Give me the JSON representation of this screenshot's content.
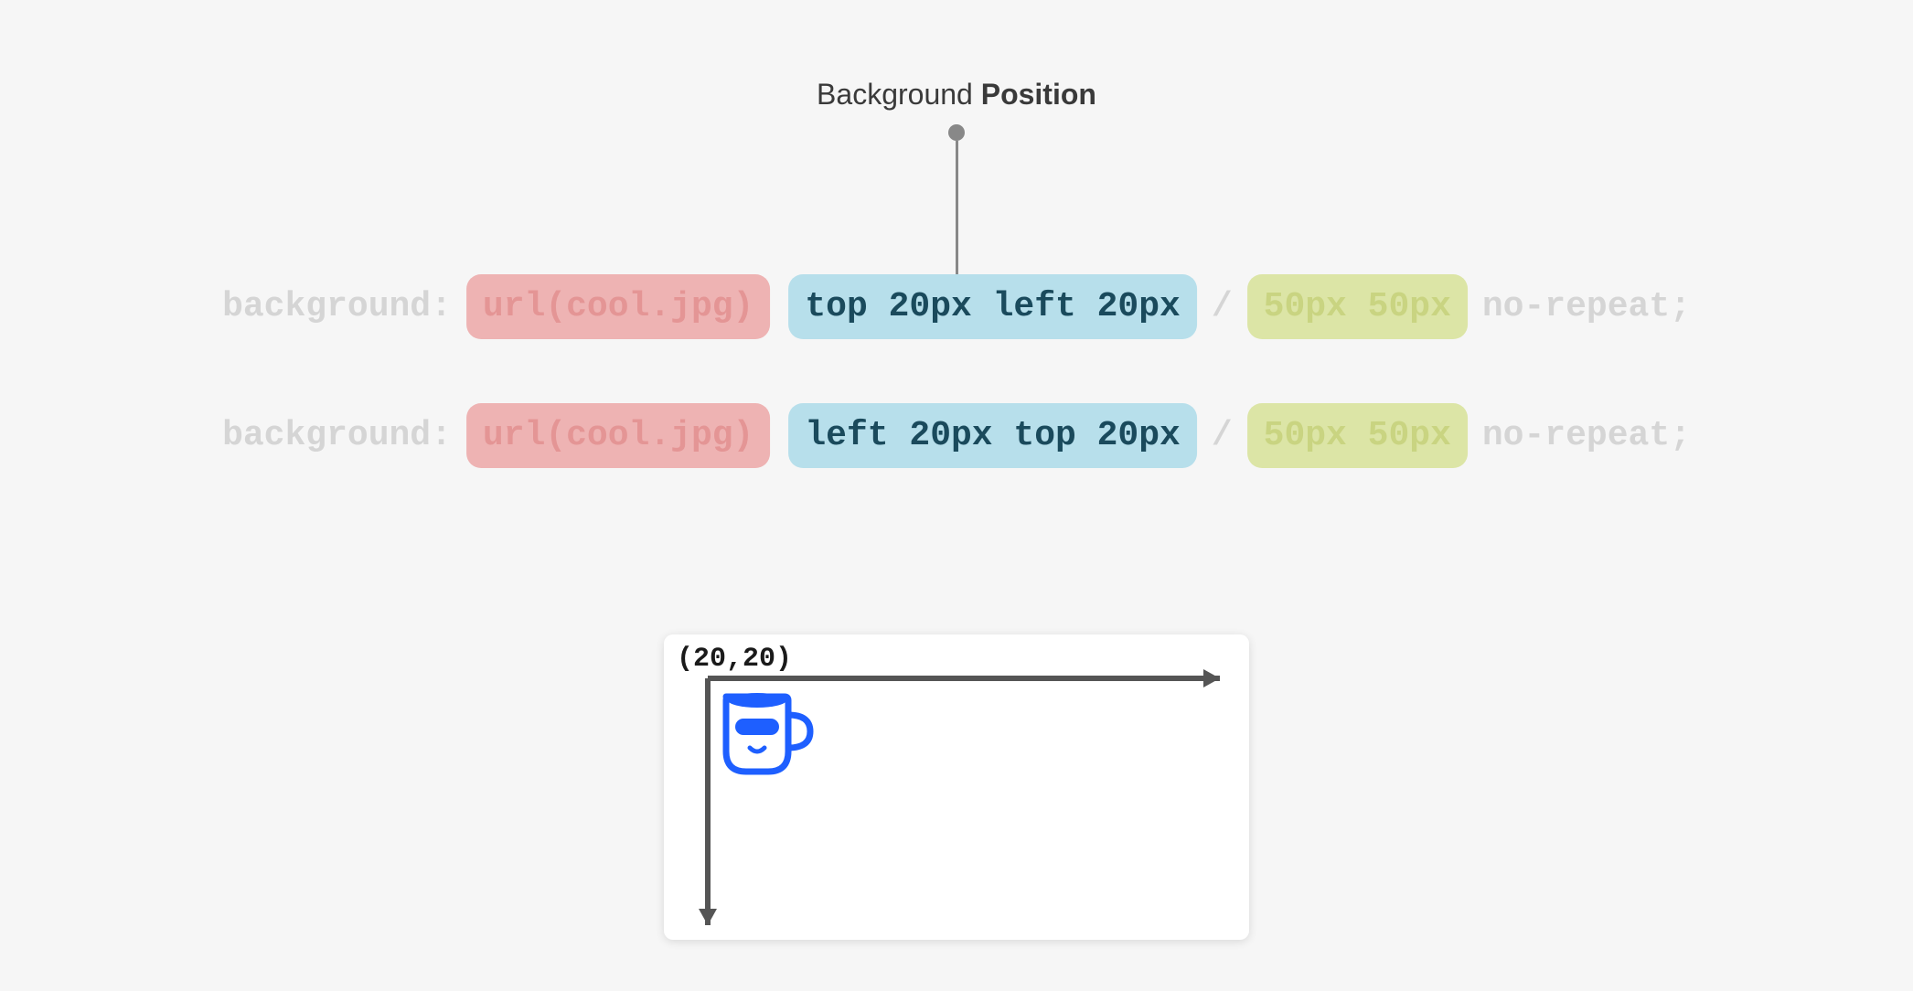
{
  "heading": {
    "prefix": "Background ",
    "bold": "Position"
  },
  "rows": [
    {
      "property": "background:",
      "url": "url(cool.jpg)",
      "position": "top 20px left 20px",
      "separator": "/",
      "size": "50px 50px",
      "repeat": "no-repeat;"
    },
    {
      "property": "background:",
      "url": "url(cool.jpg)",
      "position": "left 20px top 20px",
      "separator": "/",
      "size": "50px 50px",
      "repeat": "no-repeat;"
    }
  ],
  "preview": {
    "coord_label": "(20,20)"
  },
  "colors": {
    "bg": "#f6f6f6",
    "muted": "#d5d5d5",
    "pill_red_bg": "#eeb3b3",
    "pill_blue_bg": "#b7dfeb",
    "pill_blue_text": "#1a4a5c",
    "pill_green_bg": "#dce5a6",
    "axis": "#555555",
    "mug": "#1e5fff"
  }
}
